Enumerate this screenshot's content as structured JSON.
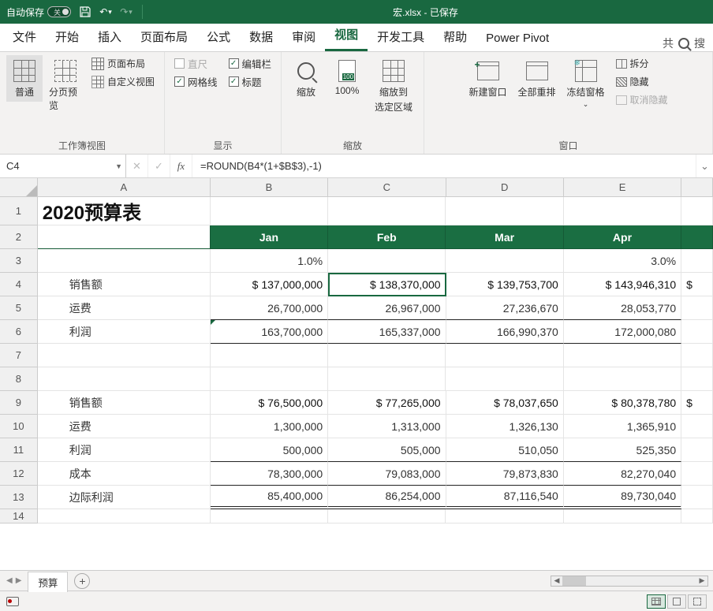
{
  "titlebar": {
    "autosave_label": "自动保存",
    "autosave_state": "关",
    "file_title": "宏.xlsx - 已保存"
  },
  "ribbon": {
    "tabs": [
      "文件",
      "开始",
      "插入",
      "页面布局",
      "公式",
      "数据",
      "审阅",
      "视图",
      "开发工具",
      "帮助",
      "Power Pivot"
    ],
    "active_tab": "视图",
    "search_label": "搜",
    "share_label": "共",
    "groups": {
      "views": {
        "label": "工作簿视图",
        "normal": "普通",
        "page_break": "分页预览",
        "page_layout": "页面布局",
        "custom": "自定义视图"
      },
      "show": {
        "label": "显示",
        "ruler": "直尺",
        "formula_bar": "编辑栏",
        "gridlines": "网格线",
        "headings": "标题"
      },
      "zoom": {
        "label": "缩放",
        "zoom": "缩放",
        "hundred": "100%",
        "to_selection_l1": "缩放到",
        "to_selection_l2": "选定区域"
      },
      "window": {
        "label": "窗口",
        "new_window": "新建窗口",
        "arrange": "全部重排",
        "freeze": "冻结窗格",
        "split": "拆分",
        "hide": "隐藏",
        "unhide": "取消隐藏"
      }
    }
  },
  "formula_bar": {
    "name_box": "C4",
    "formula": "=ROUND(B4*(1+$B$3),-1)"
  },
  "columns": [
    "A",
    "B",
    "C",
    "D",
    "E"
  ],
  "rows": {
    "title": "2020预算表",
    "months": [
      "Jan",
      "Feb",
      "Mar",
      "Apr"
    ],
    "r3": {
      "B": "1.0%",
      "E": "3.0%"
    },
    "r4": {
      "A": "销售额",
      "B": "$   137,000,000",
      "C": "$   138,370,000",
      "D": "$   139,753,700",
      "E": "$   143,946,310",
      "F": "$"
    },
    "r5": {
      "A": "运费",
      "B": "26,700,000",
      "C": "26,967,000",
      "D": "27,236,670",
      "E": "28,053,770"
    },
    "r6": {
      "A": "利润",
      "B": "163,700,000",
      "C": "165,337,000",
      "D": "166,990,370",
      "E": "172,000,080"
    },
    "r9": {
      "A": "销售额",
      "B": "$     76,500,000",
      "C": "$     77,265,000",
      "D": "$     78,037,650",
      "E": "$     80,378,780",
      "F": "$"
    },
    "r10": {
      "A": "运费",
      "B": "1,300,000",
      "C": "1,313,000",
      "D": "1,326,130",
      "E": "1,365,910"
    },
    "r11": {
      "A": "利润",
      "B": "500,000",
      "C": "505,000",
      "D": "510,050",
      "E": "525,350"
    },
    "r12": {
      "A": "成本",
      "B": "78,300,000",
      "C": "79,083,000",
      "D": "79,873,830",
      "E": "82,270,040"
    },
    "r13": {
      "A": "边际利润",
      "B": "85,400,000",
      "C": "86,254,000",
      "D": "87,116,540",
      "E": "89,730,040"
    }
  },
  "sheet": {
    "tab": "预算"
  },
  "chart_data": {
    "type": "table",
    "title": "2020预算表",
    "columns": [
      "",
      "Jan",
      "Feb",
      "Mar",
      "Apr"
    ],
    "growth_rate": {
      "Jan": 0.01,
      "Apr": 0.03
    },
    "block1": {
      "销售额": [
        137000000,
        138370000,
        139753700,
        143946310
      ],
      "运费": [
        26700000,
        26967000,
        27236670,
        28053770
      ],
      "利润": [
        163700000,
        165337000,
        166990370,
        172000080
      ]
    },
    "block2": {
      "销售额": [
        76500000,
        77265000,
        78037650,
        80378780
      ],
      "运费": [
        1300000,
        1313000,
        1326130,
        1365910
      ],
      "利润": [
        500000,
        505000,
        510050,
        525350
      ],
      "成本": [
        78300000,
        79083000,
        79873830,
        82270040
      ],
      "边际利润": [
        85400000,
        86254000,
        87116540,
        89730040
      ]
    }
  }
}
